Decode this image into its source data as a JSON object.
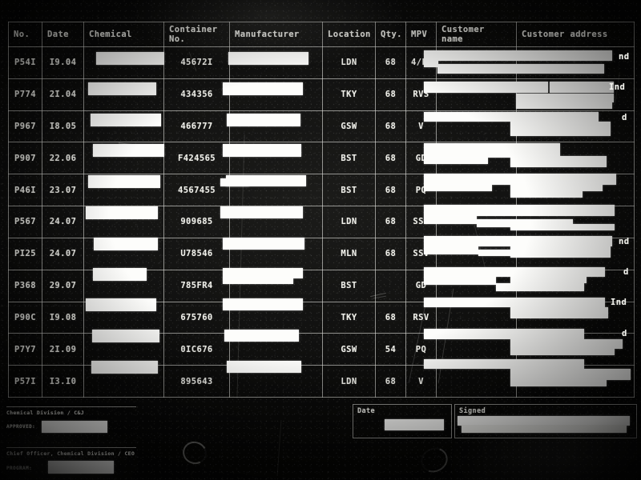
{
  "document": {
    "kind": "redacted-chemical-shipment-ledger",
    "table": {
      "headers": {
        "no": "No.",
        "date": "Date",
        "chemical": "Chemical",
        "container_no_line1": "Container",
        "container_no_line2": "No.",
        "manufacturer": "Manufacturer",
        "location": "Location",
        "qty": "Qty.",
        "mpv": "MPV",
        "customer_name": "Customer name",
        "customer_address": "Customer address"
      },
      "rows": [
        {
          "no": "P54I",
          "date": "I9.04",
          "chemical": "",
          "container": "45672I",
          "manufacturer": "",
          "location": "LDN",
          "qty": "68",
          "mpv": "4/FG",
          "customer_name": "",
          "customer_address": "",
          "address_fragment": "nd"
        },
        {
          "no": "P774",
          "date": "2I.04",
          "chemical": "",
          "container": "434356",
          "manufacturer": "",
          "location": "TKY",
          "qty": "68",
          "mpv": "RVS",
          "customer_name": "",
          "customer_address": "",
          "address_fragment": "Ind"
        },
        {
          "no": "P967",
          "date": "I8.05",
          "chemical": "",
          "container": "466777",
          "manufacturer": "",
          "location": "GSW",
          "qty": "68",
          "mpv": "V",
          "customer_name": "",
          "customer_address": "",
          "address_fragment": "d"
        },
        {
          "no": "P907",
          "date": "22.06",
          "chemical": "",
          "container": "F424565",
          "manufacturer": "",
          "location": "BST",
          "qty": "68",
          "mpv": "GD",
          "customer_name": "",
          "customer_address": "",
          "address_fragment": ""
        },
        {
          "no": "P46I",
          "date": "23.07",
          "chemical": "",
          "container": "4567455",
          "manufacturer": "",
          "location": "BST",
          "qty": "68",
          "mpv": "PQ",
          "customer_name": "",
          "customer_address": "",
          "address_fragment": ""
        },
        {
          "no": "P567",
          "date": "24.07",
          "chemical": "",
          "container": "909685",
          "manufacturer": "",
          "location": "LDN",
          "qty": "68",
          "mpv": "SSV",
          "customer_name": "",
          "customer_address": "",
          "address_fragment": "nd"
        },
        {
          "no": "PI25",
          "date": "24.07",
          "chemical": "",
          "container": "U78546",
          "manufacturer": "",
          "location": "MLN",
          "qty": "68",
          "mpv": "SSV",
          "customer_name": "",
          "customer_address": "",
          "address_fragment": "d"
        },
        {
          "no": "P368",
          "date": "29.07",
          "chemical": "",
          "container": "785FR4",
          "manufacturer": "",
          "location": "BST",
          "qty": "",
          "mpv": "GD",
          "customer_name": "",
          "customer_address": "",
          "address_fragment": "Ind"
        },
        {
          "no": "P90C",
          "date": "I9.08",
          "chemical": "",
          "container": "675760",
          "manufacturer": "",
          "location": "TKY",
          "qty": "68",
          "mpv": "RSV",
          "customer_name": "",
          "customer_address": "",
          "address_fragment": "d"
        },
        {
          "no": "P7Y7",
          "date": "2I.09",
          "chemical": "",
          "container": "0IC676",
          "manufacturer": "",
          "location": "GSW",
          "qty": "54",
          "mpv": "PQ",
          "customer_name": "",
          "customer_address": "",
          "address_fragment": ""
        },
        {
          "no": "P57I",
          "date": "I3.I0",
          "chemical": "",
          "container": "895643",
          "manufacturer": "",
          "location": "LDN",
          "qty": "68",
          "mpv": "V",
          "customer_name": "",
          "customer_address": "",
          "address_fragment": ""
        }
      ]
    },
    "footer": {
      "division_line": "Chemical Division / C&J",
      "approved_label": "APPROVED:",
      "approved_value": "",
      "officer_line": "Chief Officer, Chemical Division / CEO",
      "program_label": "PROGRAM:",
      "program_value": "",
      "date_box_title": "Date",
      "date_box_value": "",
      "signed_box_title": "Signed",
      "signed_box_value": ""
    }
  },
  "colors": {
    "paper": "#0b0b0a",
    "ink": "#efefe9",
    "redaction": "#fdfdfb",
    "rule": "rgba(225,225,220,0.62)"
  }
}
